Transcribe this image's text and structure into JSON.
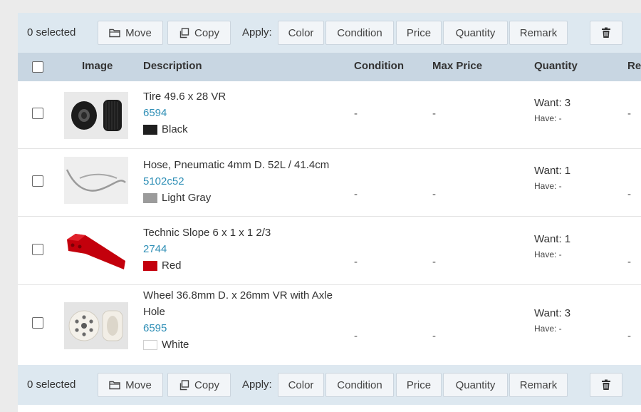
{
  "toolbar": {
    "selected": "0 selected",
    "move": "Move",
    "copy": "Copy",
    "apply_label": "Apply:",
    "apply_buttons": [
      "Color",
      "Condition",
      "Price",
      "Quantity",
      "Remark"
    ]
  },
  "columns": {
    "image": "Image",
    "description": "Description",
    "condition": "Condition",
    "max_price": "Max Price",
    "quantity": "Quantity",
    "remark": "Re"
  },
  "rows": [
    {
      "title_lines": [
        "Tire 49.6 x 28 VR"
      ],
      "part": "6594",
      "color_name": "Black",
      "color_hex": "#1f1f1f",
      "condition": "-",
      "max_price": "-",
      "want": "Want: 3",
      "have": "Have: -",
      "remark": "-"
    },
    {
      "title_lines": [
        "Hose, Pneumatic 4mm D. 52L / 41.4cm"
      ],
      "part": "5102c52",
      "color_name": "Light Gray",
      "color_hex": "#9b9b9b",
      "condition": "-",
      "max_price": "-",
      "want": "Want: 1",
      "have": "Have: -",
      "remark": "-"
    },
    {
      "title_lines": [
        "Technic Slope 6 x 1 x 1 2/3"
      ],
      "part": "2744",
      "color_name": "Red",
      "color_hex": "#c4000d",
      "condition": "-",
      "max_price": "-",
      "want": "Want: 1",
      "have": "Have: -",
      "remark": "-"
    },
    {
      "title_lines": [
        "Wheel 36.8mm D. x 26mm VR with Axle",
        "Hole"
      ],
      "part": "6595",
      "color_name": "White",
      "color_hex": "#ffffff",
      "condition": "-",
      "max_price": "-",
      "want": "Want: 3",
      "have": "Have: -",
      "remark": "-"
    }
  ]
}
